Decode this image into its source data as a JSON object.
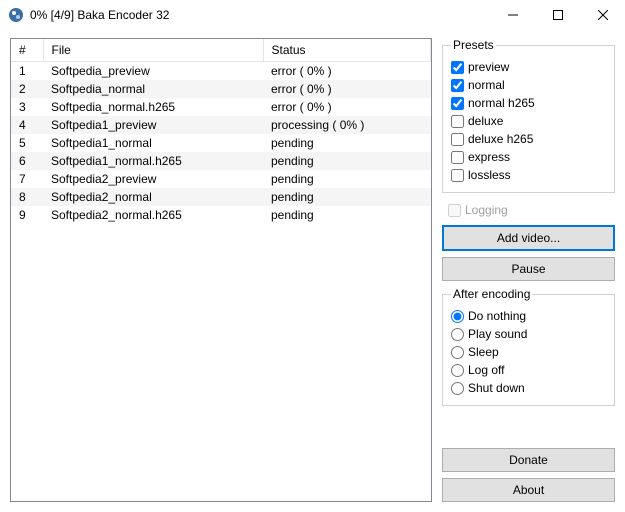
{
  "window": {
    "title": "0% [4/9] Baka Encoder 32"
  },
  "table": {
    "headers": {
      "num": "#",
      "file": "File",
      "status": "Status"
    },
    "rows": [
      {
        "num": "1",
        "file": "Softpedia_preview",
        "status": "error ( 0% )"
      },
      {
        "num": "2",
        "file": "Softpedia_normal",
        "status": "error ( 0% )"
      },
      {
        "num": "3",
        "file": "Softpedia_normal.h265",
        "status": "error ( 0% )"
      },
      {
        "num": "4",
        "file": "Softpedia1_preview",
        "status": "processing ( 0% )"
      },
      {
        "num": "5",
        "file": "Softpedia1_normal",
        "status": "pending"
      },
      {
        "num": "6",
        "file": "Softpedia1_normal.h265",
        "status": "pending"
      },
      {
        "num": "7",
        "file": "Softpedia2_preview",
        "status": "pending"
      },
      {
        "num": "8",
        "file": "Softpedia2_normal",
        "status": "pending"
      },
      {
        "num": "9",
        "file": "Softpedia2_normal.h265",
        "status": "pending"
      }
    ]
  },
  "presets": {
    "legend": "Presets",
    "items": [
      {
        "label": "preview",
        "checked": true
      },
      {
        "label": "normal",
        "checked": true
      },
      {
        "label": "normal h265",
        "checked": true
      },
      {
        "label": "deluxe",
        "checked": false
      },
      {
        "label": "deluxe h265",
        "checked": false
      },
      {
        "label": "express",
        "checked": false
      },
      {
        "label": "lossless",
        "checked": false
      }
    ]
  },
  "logging": {
    "label": "Logging",
    "checked": false
  },
  "buttons": {
    "add_video": "Add video...",
    "pause": "Pause",
    "donate": "Donate",
    "about": "About"
  },
  "after_encoding": {
    "legend": "After encoding",
    "options": [
      {
        "label": "Do nothing",
        "selected": true
      },
      {
        "label": "Play sound",
        "selected": false
      },
      {
        "label": "Sleep",
        "selected": false
      },
      {
        "label": "Log off",
        "selected": false
      },
      {
        "label": "Shut down",
        "selected": false
      }
    ]
  }
}
